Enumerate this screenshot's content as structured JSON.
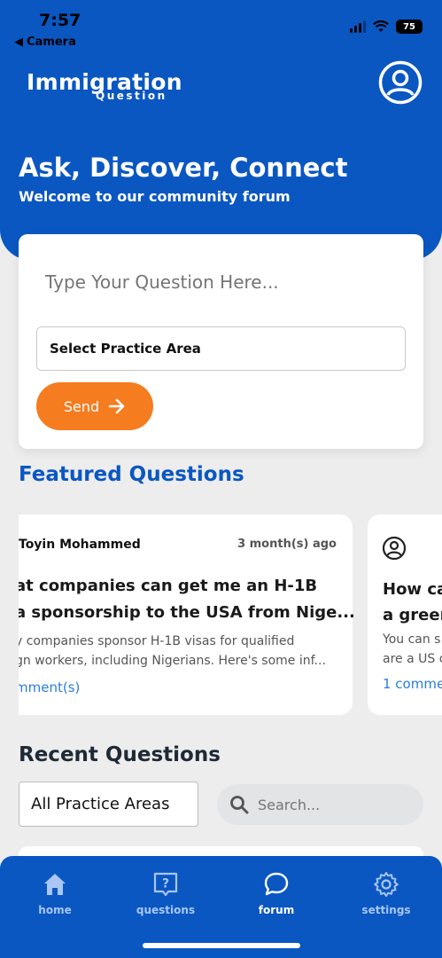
{
  "status": {
    "time": "7:57",
    "back_label": "Camera",
    "battery": "75"
  },
  "header": {
    "logo_main": "Immigration",
    "logo_sub": "Question",
    "title": "Ask, Discover, Connect",
    "subtitle": "Welcome to our community forum"
  },
  "ask": {
    "placeholder": "Type Your Question Here...",
    "practice_label": "Select Practice Area",
    "send_label": "Send"
  },
  "featured": {
    "title": "Featured Questions",
    "cards": [
      {
        "author": "Toyin Mohammed",
        "time": "3 month(s) ago",
        "title_line1": "at companies can get me an H-1B",
        "title_line2": "a sponsorship to the USA from Nige...",
        "body_line1": "y companies sponsor H-1B visas for qualified",
        "body_line2": "gn workers, including Nigerians. Here's some inf...",
        "comments": "mment(s)"
      },
      {
        "title_line1": "How ca",
        "title_line2": "a green",
        "body_line1": "You can s",
        "body_line2": "are a US c",
        "comments": "1 commen"
      }
    ]
  },
  "recent": {
    "title": "Recent Questions",
    "area_filter": "All Practice Areas",
    "search_placeholder": "Search..."
  },
  "nav": {
    "items": [
      {
        "label": "home",
        "icon": "home-icon"
      },
      {
        "label": "questions",
        "icon": "question-icon"
      },
      {
        "label": "forum",
        "icon": "chat-icon"
      },
      {
        "label": "settings",
        "icon": "gear-icon"
      }
    ],
    "active": "forum"
  },
  "colors": {
    "primary": "#0a57c2",
    "accent": "#f57c1f",
    "link": "#2a7de1"
  }
}
